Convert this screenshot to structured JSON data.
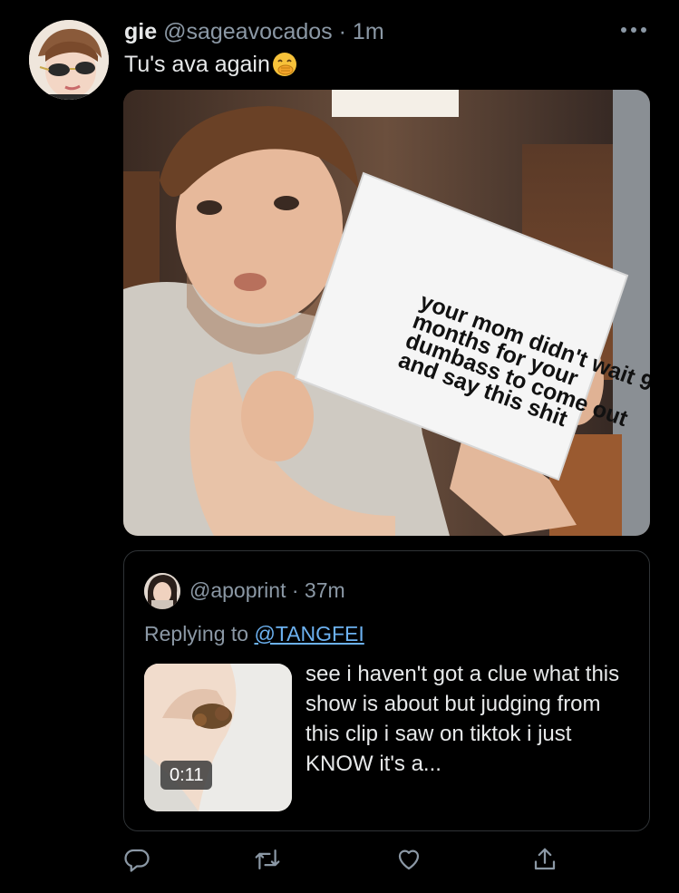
{
  "tweet": {
    "name": "gie",
    "handle": "@sageavocados",
    "separator": "·",
    "time": "1m",
    "text": "Tu's ava again",
    "emoji": "face-with-hand-over-mouth-emoji",
    "media": {
      "sign_text": "your mom didn't wait 9 months for your dumbass to come out and say this shit"
    }
  },
  "quote": {
    "handle": "@apoprint",
    "separator": "·",
    "time": "37m",
    "replying_prefix": "Replying to",
    "replying_to": "@TANGFEI",
    "video_duration": "0:11",
    "text": "see i haven't got a clue what this show is about but judging from this clip i saw on tiktok i just KNOW it's a..."
  },
  "actions": {
    "reply_icon": "reply-icon",
    "retweet_icon": "retweet-icon",
    "like_icon": "heart-icon",
    "share_icon": "share-icon"
  },
  "colors": {
    "background": "#000000",
    "primary_text": "#e7e9ea",
    "secondary_text": "#8b98a5",
    "link": "#6cb1f0",
    "border": "#2f3336"
  }
}
